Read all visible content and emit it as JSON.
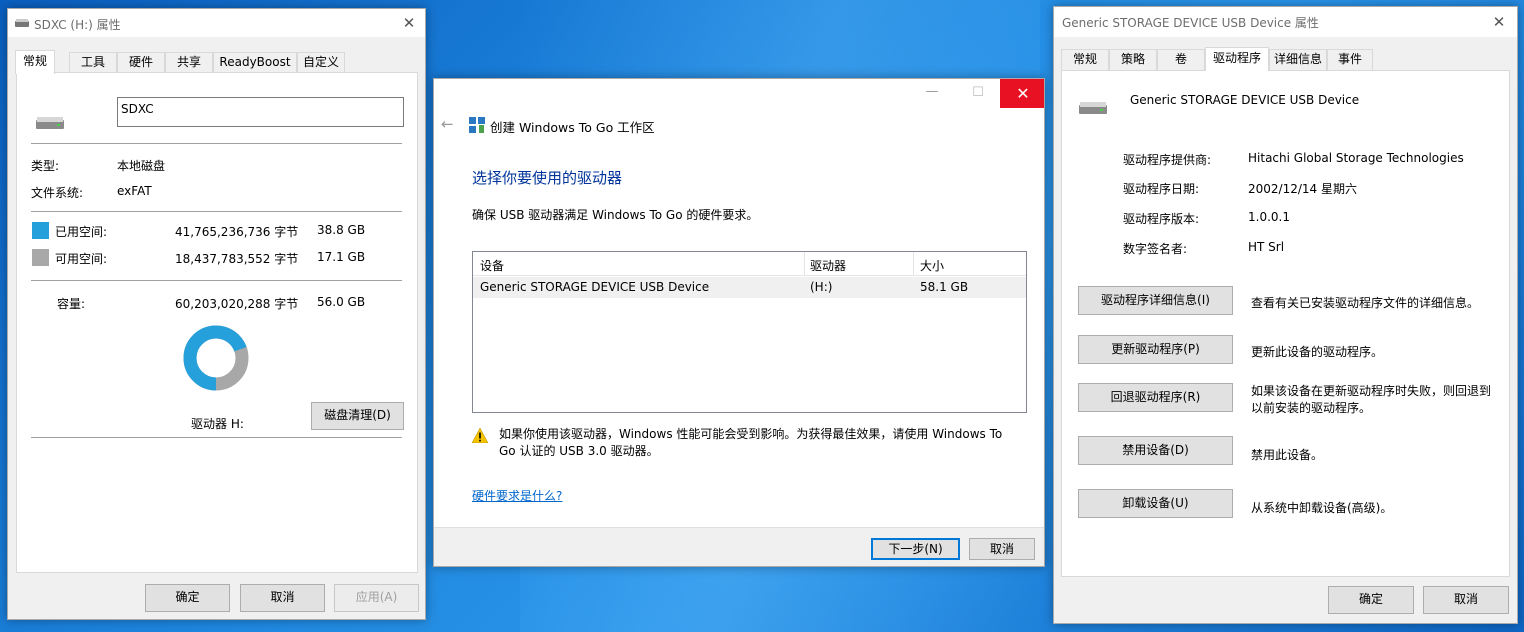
{
  "sdxc": {
    "title": "SDXC (H:) 属性",
    "tabs": [
      "常规",
      "工具",
      "硬件",
      "共享",
      "ReadyBoost",
      "自定义"
    ],
    "name_value": "SDXC",
    "type_label": "类型:",
    "type_value": "本地磁盘",
    "fs_label": "文件系统:",
    "fs_value": "exFAT",
    "used_label": "已用空间:",
    "used_bytes": "41,765,236,736 字节",
    "used_size": "38.8 GB",
    "free_label": "可用空间:",
    "free_bytes": "18,437,783,552 字节",
    "free_size": "17.1 GB",
    "capacity_label": "容量:",
    "capacity_bytes": "60,203,020,288 字节",
    "capacity_size": "56.0 GB",
    "drive_label": "驱动器 H:",
    "cleanup_button": "磁盘清理(D)",
    "ok_button": "确定",
    "cancel_button": "取消",
    "apply_button": "应用(A)",
    "used_fraction": 0.694,
    "colors": {
      "used": "#26a0da",
      "free": "#a8a8a8"
    }
  },
  "wtg": {
    "header": "创建 Windows To Go 工作区",
    "heading": "选择你要使用的驱动器",
    "subtitle": "确保 USB 驱动器满足 Windows To Go 的硬件要求。",
    "columns": [
      "设备",
      "驱动器",
      "大小"
    ],
    "rows": [
      {
        "device": "Generic STORAGE DEVICE USB Device",
        "drive": "(H:)",
        "size": "58.1 GB"
      }
    ],
    "warning": "如果你使用该驱动器，Windows 性能可能会受到影响。为获得最佳效果，请使用 Windows To Go 认证的 USB 3.0 驱动器。",
    "link": "硬件要求是什么?",
    "next_button": "下一步(N)",
    "cancel_button": "取消",
    "colors": {
      "heading": "#003399",
      "close_bg": "#e81123",
      "link": "#0066cc"
    }
  },
  "usbdev": {
    "title": "Generic STORAGE DEVICE USB Device 属性",
    "tabs": [
      "常规",
      "策略",
      "卷",
      "驱动程序",
      "详细信息",
      "事件"
    ],
    "device_name": "Generic STORAGE DEVICE USB Device",
    "props": [
      {
        "label": "驱动程序提供商:",
        "value": "Hitachi Global Storage Technologies"
      },
      {
        "label": "驱动程序日期:",
        "value": "2002/12/14 星期六"
      },
      {
        "label": "驱动程序版本:",
        "value": "1.0.0.1"
      },
      {
        "label": "数字签名者:",
        "value": "HT Srl"
      }
    ],
    "actions": [
      {
        "button": "驱动程序详细信息(I)",
        "desc": "查看有关已安装驱动程序文件的详细信息。"
      },
      {
        "button": "更新驱动程序(P)",
        "desc": "更新此设备的驱动程序。"
      },
      {
        "button": "回退驱动程序(R)",
        "desc": "如果该设备在更新驱动程序时失败，则回退到以前安装的驱动程序。"
      },
      {
        "button": "禁用设备(D)",
        "desc": "禁用此设备。"
      },
      {
        "button": "卸载设备(U)",
        "desc": "从系统中卸载设备(高级)。"
      }
    ],
    "ok_button": "确定",
    "cancel_button": "取消"
  }
}
